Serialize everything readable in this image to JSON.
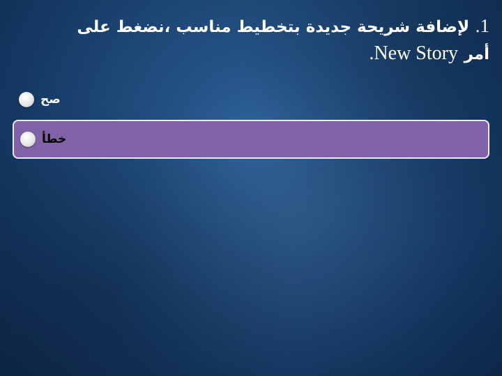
{
  "question": {
    "number": "1.",
    "text_ar": "لإضافة شريحة جديدة بتخطيط مناسب ،نضغط على أمر",
    "command_en": "New Story",
    "end_punct": "."
  },
  "options": [
    {
      "label": "صح",
      "selected": false
    },
    {
      "label": "خطأ",
      "selected": true
    }
  ],
  "colors": {
    "background": "#1f4a7a",
    "selected_option": "#8063a6",
    "text": "#ffffff"
  }
}
